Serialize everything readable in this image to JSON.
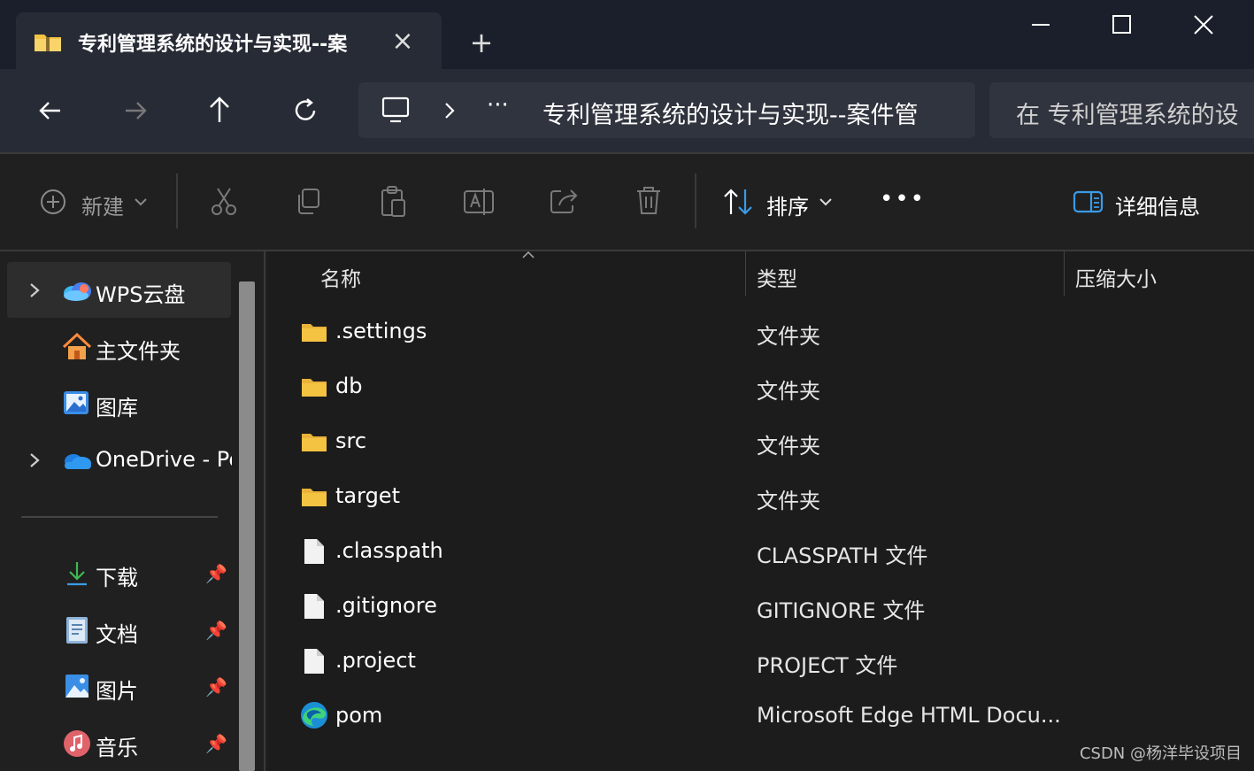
{
  "window": {
    "tab_title": "专利管理系统的设计与实现--案",
    "close_tab": "×",
    "new_tab": "+"
  },
  "address": {
    "overflow": "···",
    "path": "专利管理系统的设计与实现--案件管",
    "search_placeholder": "在 专利管理系统的设"
  },
  "toolbar": {
    "new_label": "新建",
    "sort_label": "排序",
    "more_label": "•••",
    "details_label": "详细信息"
  },
  "sidebar": {
    "items": [
      {
        "label": "WPS云盘",
        "icon": "wps-cloud-icon"
      },
      {
        "label": "主文件夹",
        "icon": "home-icon"
      },
      {
        "label": "图库",
        "icon": "gallery-icon"
      },
      {
        "label": "OneDrive - Pe",
        "icon": "onedrive-icon"
      }
    ],
    "pinned": [
      {
        "label": "下载",
        "icon": "download-icon"
      },
      {
        "label": "文档",
        "icon": "documents-icon"
      },
      {
        "label": "图片",
        "icon": "pictures-icon"
      },
      {
        "label": "音乐",
        "icon": "music-icon"
      }
    ]
  },
  "filelist": {
    "columns": {
      "name": "名称",
      "type": "类型",
      "size": "压缩大小"
    },
    "rows": [
      {
        "name": ".settings",
        "type": "文件夹",
        "icon": "folder-icon"
      },
      {
        "name": "db",
        "type": "文件夹",
        "icon": "folder-icon"
      },
      {
        "name": "src",
        "type": "文件夹",
        "icon": "folder-icon"
      },
      {
        "name": "target",
        "type": "文件夹",
        "icon": "folder-icon"
      },
      {
        "name": ".classpath",
        "type": "CLASSPATH 文件",
        "icon": "file-icon"
      },
      {
        "name": ".gitignore",
        "type": "GITIGNORE 文件",
        "icon": "file-icon"
      },
      {
        "name": ".project",
        "type": "PROJECT 文件",
        "icon": "file-icon"
      },
      {
        "name": "pom",
        "type": "Microsoft Edge HTML Docu...",
        "icon": "edge-icon"
      }
    ]
  },
  "watermark": "CSDN @杨洋毕设项目",
  "colors": {
    "folder": "#f5c342",
    "titlebar": "#1a1f2b",
    "accent_blue": "#3a9be8"
  }
}
